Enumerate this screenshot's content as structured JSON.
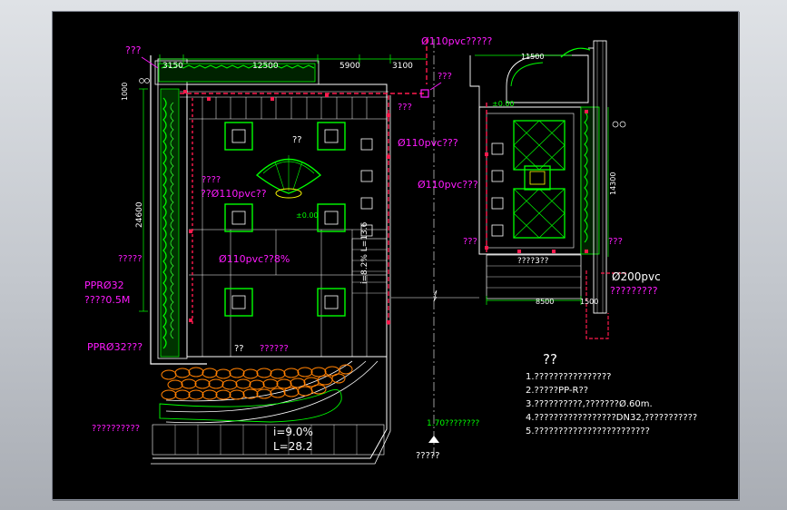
{
  "dims": {
    "d_3150": "3150",
    "d_12500": "12500",
    "d_5900": "5900",
    "d_3100": "3100",
    "d_1000": "1000",
    "d_24600": "24600",
    "d_11500": "11500",
    "d_14300": "14300",
    "d_8500": "8500",
    "d_1500": "1500"
  },
  "labels": {
    "top_left_q": "???",
    "pipe_top": "Ø110pvc?????",
    "q_top_right": "???",
    "q_near_pipe": "???",
    "pvc_mid1": "Ø110pvc???",
    "pvc_mid2": "Ø110pvc???",
    "q_left_a": "????",
    "q_left_b": "??Ø110pvc??",
    "center_qq": "??",
    "elev_center": "±0.00",
    "pvc_low": "Ø110pvc??8%",
    "left_q4": "?????",
    "ppr1": "PPRØ32",
    "ppr1_sub": "????0.5M",
    "ppr2": "PPRØ32???",
    "bottom_q10": "??????????",
    "bottom_qq": "??",
    "bottom_q6": "??????",
    "slope_i": "i=9.0%",
    "slope_L": "L=28.2",
    "vert_label": "i=8.2%  L=13.6",
    "elev_right": "1.70????????",
    "bottom_q5": "?????",
    "right_q3a": "???",
    "right_q3b": "???",
    "right_q6": "????3??",
    "right_pipe": "Ø200pvc",
    "right_pipe_sub": "?????????",
    "elev_right_small": "±0.00"
  },
  "notes": {
    "title": "??",
    "items": [
      "1.????????????????",
      "2.?????PP-R??",
      "3.??????????,???????Ø.60m.",
      "4.?????????????????DN32,???????????",
      "5.????????????????????????"
    ]
  },
  "colors": {
    "background": "#000000",
    "wall": "#ffffff",
    "green": "#00ff00",
    "pipe": "#ff1a4d",
    "label": "#ff1aff",
    "dim": "#00ff00",
    "paving": "#ff7f00",
    "cyan": "#00ffff",
    "yellow": "#ffff00"
  }
}
